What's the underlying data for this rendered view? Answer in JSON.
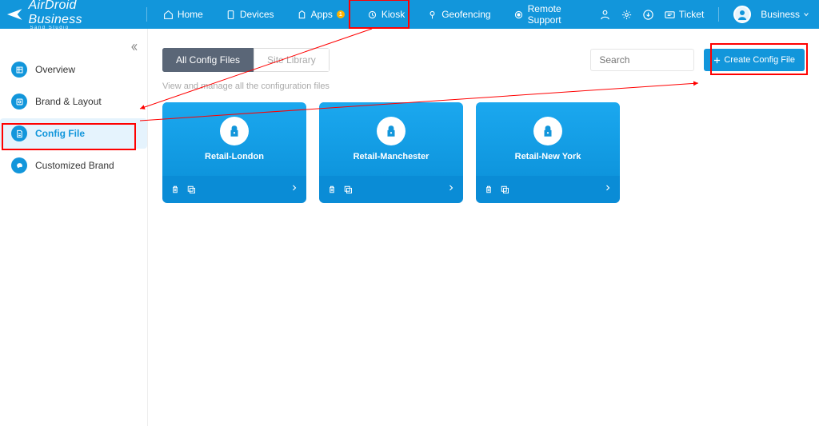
{
  "header": {
    "logo_main": "AirDroid Business",
    "logo_sub": "Sand Studio",
    "nav": [
      {
        "key": "home",
        "label": "Home"
      },
      {
        "key": "devices",
        "label": "Devices"
      },
      {
        "key": "apps",
        "label": "Apps",
        "badge": "1"
      },
      {
        "key": "kiosk",
        "label": "Kiosk"
      },
      {
        "key": "geofencing",
        "label": "Geofencing"
      },
      {
        "key": "remote",
        "label": "Remote Support"
      }
    ],
    "ticket_label": "Ticket",
    "account_label": "Business"
  },
  "sidebar": {
    "items": [
      {
        "key": "overview",
        "label": "Overview"
      },
      {
        "key": "brand-layout",
        "label": "Brand & Layout"
      },
      {
        "key": "config-file",
        "label": "Config File"
      },
      {
        "key": "customized-brand",
        "label": "Customized Brand"
      }
    ],
    "active_index": 2
  },
  "main": {
    "tabs": [
      {
        "key": "all",
        "label": "All Config Files"
      },
      {
        "key": "site",
        "label": "Site Library"
      }
    ],
    "active_tab": 0,
    "search_placeholder": "Search",
    "create_label": "Create Config File",
    "subtitle": "View and manage all the configuration files",
    "cards": [
      {
        "name": "Retail-London"
      },
      {
        "name": "Retail-Manchester"
      },
      {
        "name": "Retail-New York"
      }
    ]
  },
  "colors": {
    "primary": "#1296db",
    "highlight": "#ff0000"
  }
}
